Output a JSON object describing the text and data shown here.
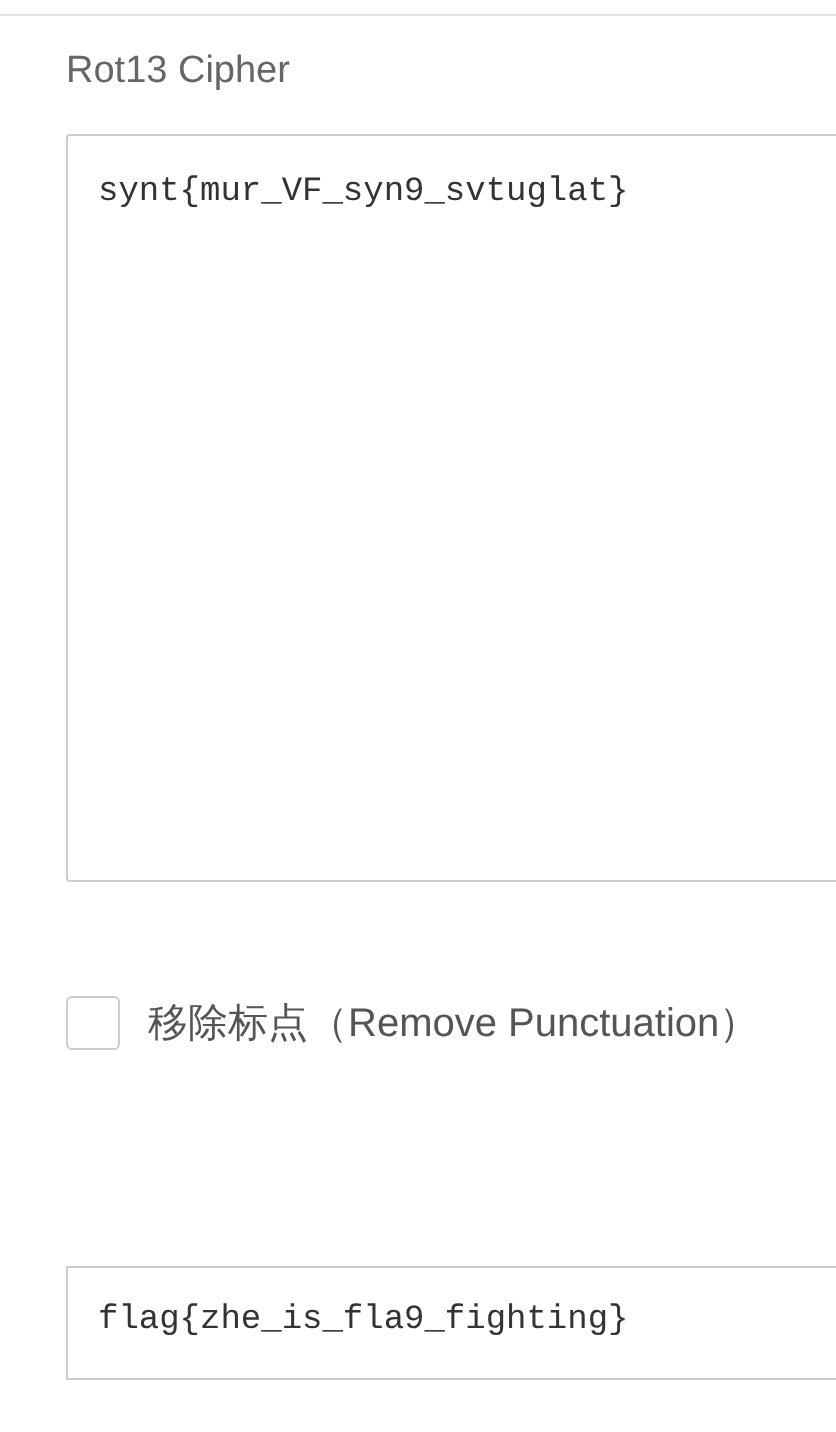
{
  "title": "Rot13 Cipher",
  "input": {
    "value": "synt{mur_VF_syn9_svtuglat}"
  },
  "remove_punctuation": {
    "label": "移除标点（Remove Punctuation）",
    "checked": false
  },
  "output": {
    "value": "flag{zhe_is_fla9_fighting}"
  }
}
